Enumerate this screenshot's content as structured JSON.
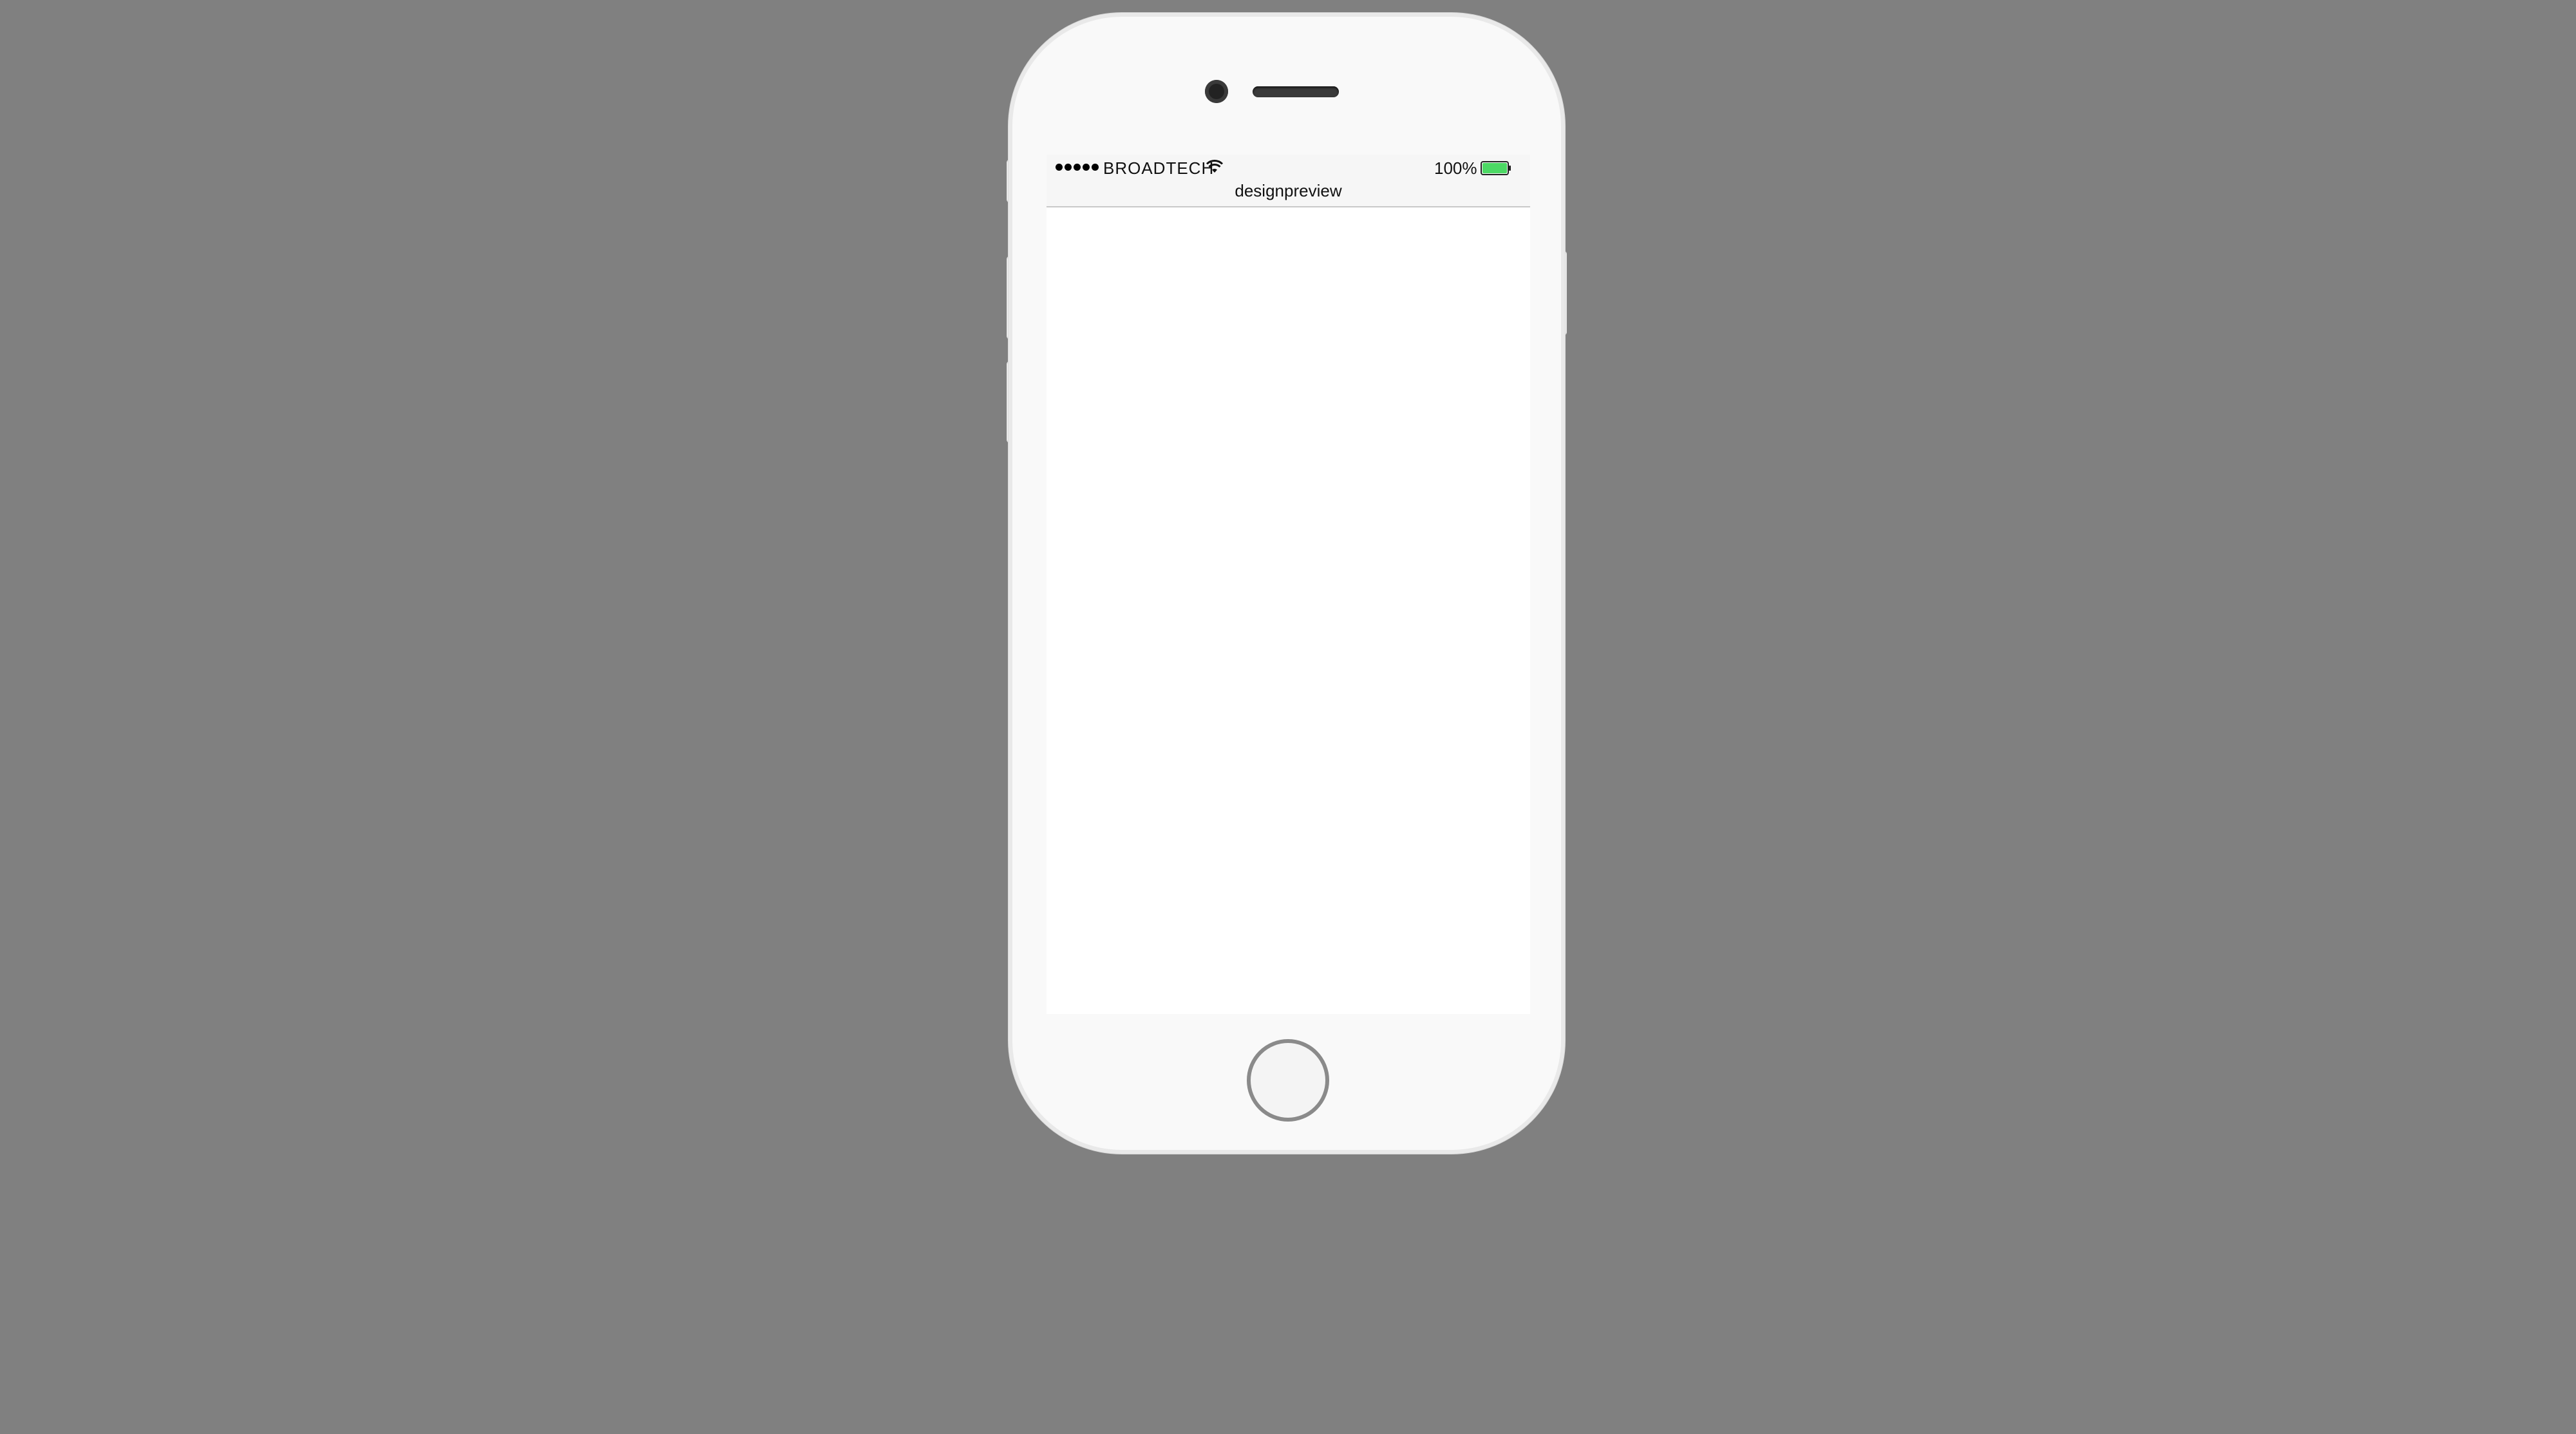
{
  "status_bar": {
    "signal_bars": 5,
    "carrier": "BROADTECH",
    "battery_percent": "100%",
    "battery_level": 1.0,
    "battery_color": "#4cd964",
    "wifi_icon": "wifi-icon"
  },
  "app": {
    "title": "designpreview"
  },
  "device": {
    "type": "iPhone",
    "color": "white",
    "background": "#808080"
  }
}
